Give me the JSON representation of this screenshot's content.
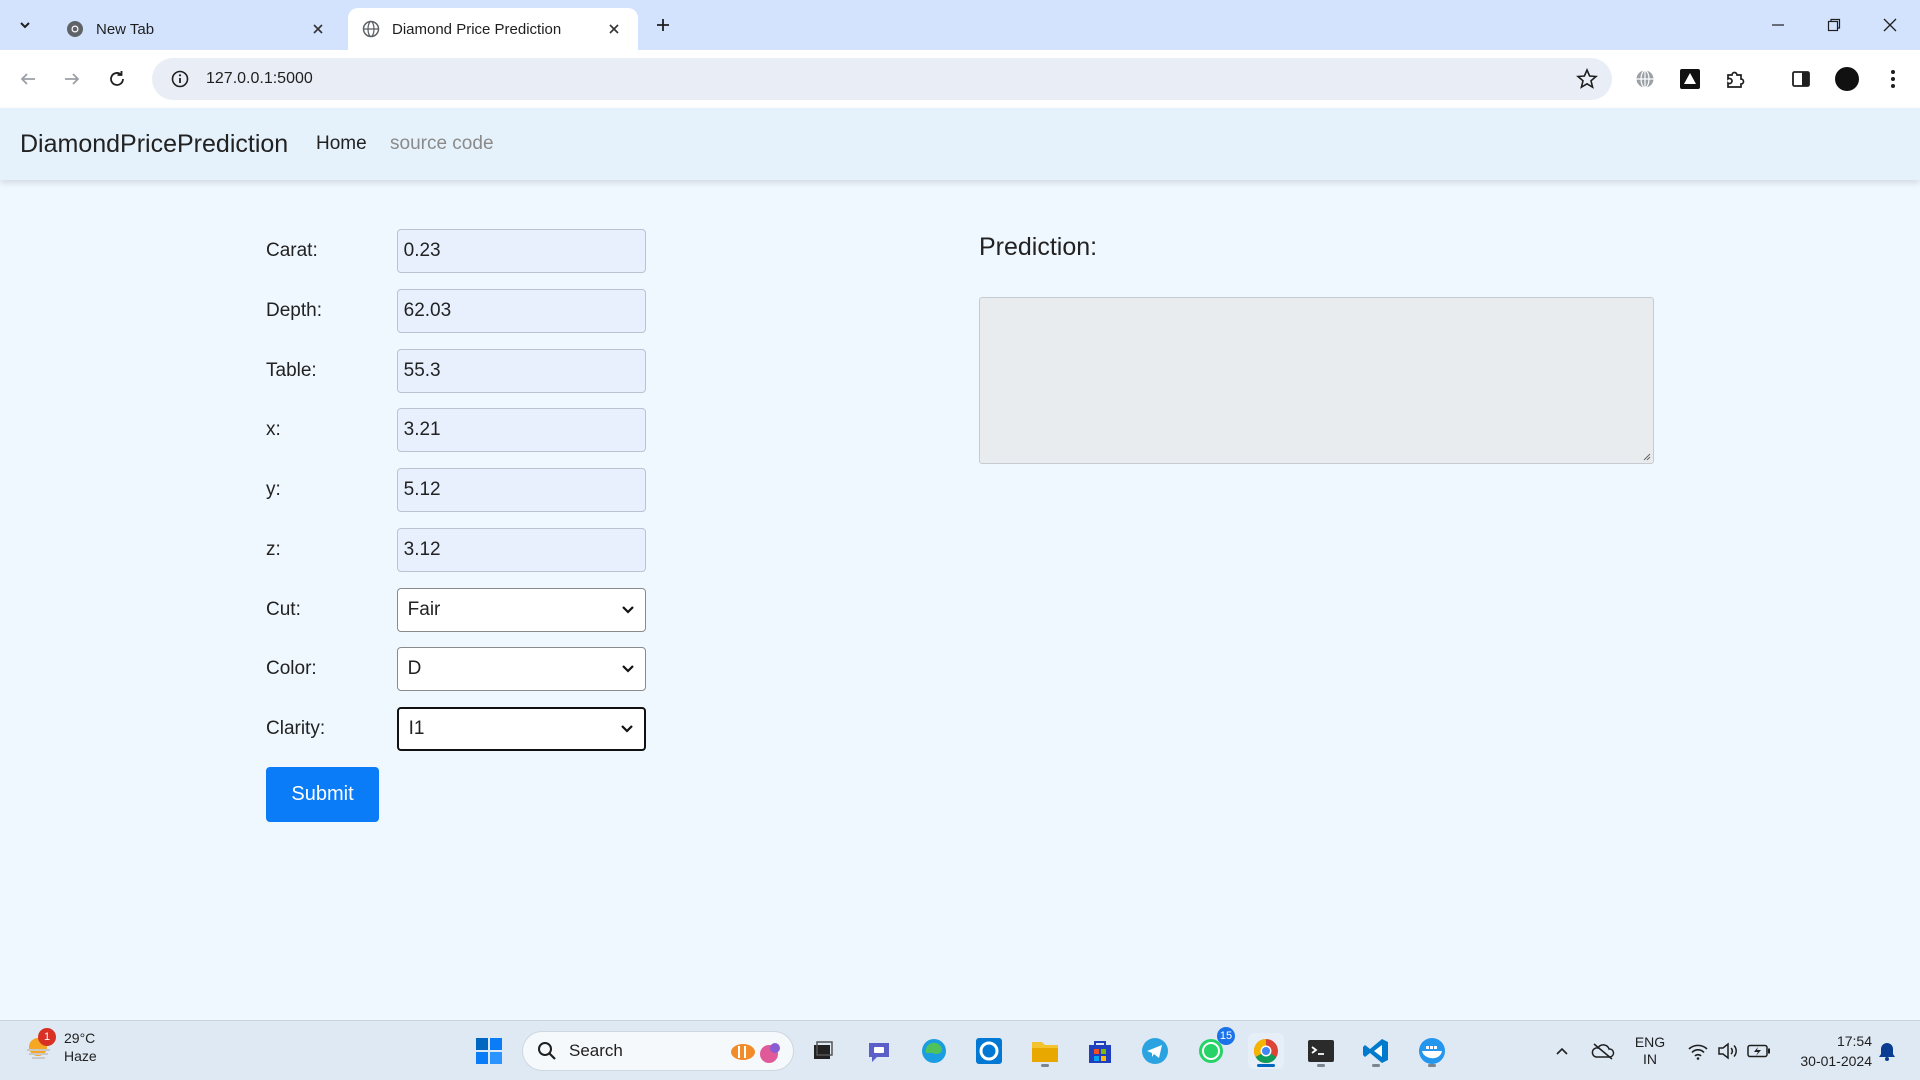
{
  "browser": {
    "tabs": [
      {
        "title": "New Tab",
        "favicon": "chrome-icon"
      },
      {
        "title": "Diamond Price Prediction",
        "favicon": "globe-icon"
      }
    ],
    "url": "127.0.0.1:5000"
  },
  "navbar": {
    "brand": "DiamondPricePrediction",
    "home": "Home",
    "source": "source code"
  },
  "form": {
    "carat": {
      "label": "Carat:",
      "value": "0.23"
    },
    "depth": {
      "label": "Depth:",
      "value": "62.03"
    },
    "table": {
      "label": "Table:",
      "value": "55.3"
    },
    "x": {
      "label": "x:",
      "value": "3.21"
    },
    "y": {
      "label": "y:",
      "value": "5.12"
    },
    "z": {
      "label": "z:",
      "value": "3.12"
    },
    "cut": {
      "label": "Cut:",
      "value": "Fair"
    },
    "color": {
      "label": "Color:",
      "value": "D"
    },
    "clarity": {
      "label": "Clarity:",
      "value": "I1"
    },
    "submit": "Submit"
  },
  "prediction": {
    "heading": "Prediction:",
    "result": ""
  },
  "taskbar": {
    "weather_temp": "29°C",
    "weather_desc": "Haze",
    "weather_badge": "1",
    "search_label": "Search",
    "whatsapp_badge": "15",
    "lang_top": "ENG",
    "lang_bottom": "IN",
    "time": "17:54",
    "date": "30-01-2024"
  },
  "colors": {
    "accent": "#0a7cf8",
    "page_bg": "#f0f8ff",
    "navbar_bg": "#e6f2fb",
    "tabstrip_bg": "#d3e3fd"
  }
}
